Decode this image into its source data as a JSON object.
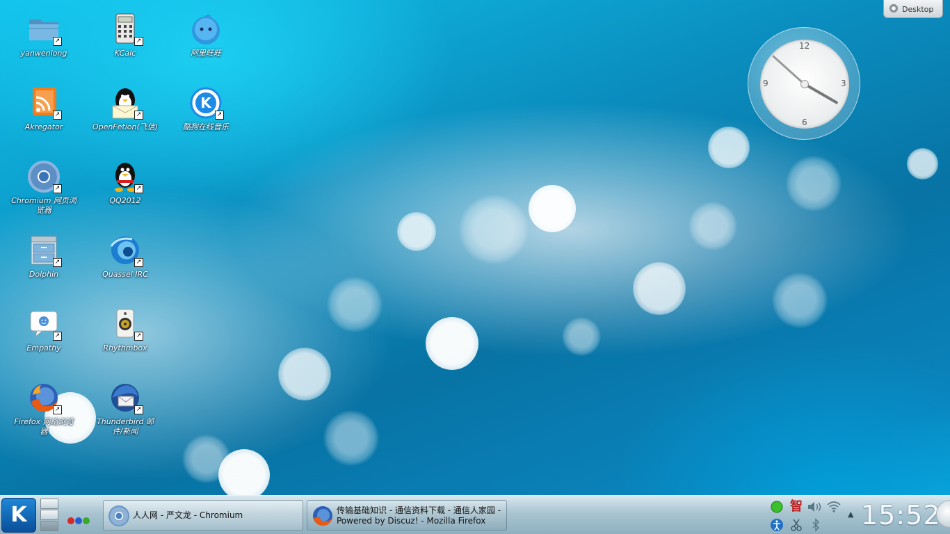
{
  "desktop": {
    "icons": [
      {
        "label": "yanwenlong",
        "icon": "folder-icon"
      },
      {
        "label": "KCalc",
        "icon": "calculator-icon"
      },
      {
        "label": "阿里旺旺",
        "icon": "aliwangwang-icon"
      },
      {
        "label": "Akregator",
        "icon": "rss-feed-icon"
      },
      {
        "label": "OpenFetion(飞信)",
        "icon": "penguin-mail-icon"
      },
      {
        "label": "酷狗在线音乐",
        "icon": "kugou-icon"
      },
      {
        "label": "Chromium 网页浏览器",
        "icon": "chromium-icon"
      },
      {
        "label": "QQ2012",
        "icon": "qq-penguin-icon"
      },
      {
        "label": "Dolphin",
        "icon": "file-cabinet-icon"
      },
      {
        "label": "Quassel IRC",
        "icon": "quassel-icon"
      },
      {
        "label": "Empathy",
        "icon": "chat-bubble-icon"
      },
      {
        "label": "Rhythmbox",
        "icon": "speaker-icon"
      },
      {
        "label": "Firefox 网络浏览器",
        "icon": "firefox-icon"
      },
      {
        "label": "Thunderbird 邮件/新闻",
        "icon": "thunderbird-icon"
      }
    ]
  },
  "toolbox": {
    "label": "Desktop"
  },
  "clock_widget": {
    "n12": "12",
    "n3": "3",
    "n6": "6",
    "n9": "9"
  },
  "taskbar": {
    "kmenu_label": "K",
    "tasks": [
      {
        "text": "人人网 - 严文龙 - Chromium"
      },
      {
        "text": "传输基础知识 - 通信资料下载 - 通信人家园 - Powered by Discuz! - Mozilla Firefox"
      }
    ],
    "tray": {
      "ime": "智"
    },
    "clock": "15:52"
  },
  "colors": {
    "accent": "#0a8fc0",
    "task_dot_red": "#d42a2a",
    "task_dot_blue": "#2a5bd4",
    "task_dot_green": "#3aa82a"
  }
}
